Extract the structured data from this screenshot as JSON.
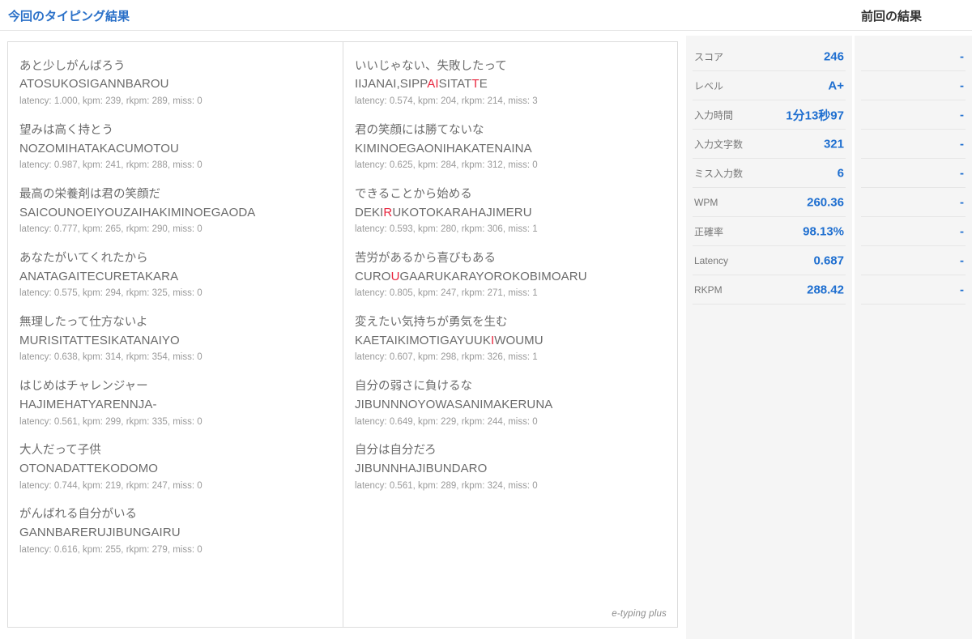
{
  "header": {
    "current_title": "今回のタイピング結果",
    "previous_title": "前回の結果"
  },
  "brand": "e-typing plus",
  "results": {
    "left_column": [
      {
        "kana": "あと少しがんばろう",
        "roman_segments": [
          {
            "text": "ATOSUKOSIGANNBAROU",
            "miss": false
          }
        ],
        "stats": "latency: 1.000, kpm: 239, rkpm: 289, miss: 0"
      },
      {
        "kana": "望みは高く持とう",
        "roman_segments": [
          {
            "text": "NOZOMIHATAKACUMOTOU",
            "miss": false
          }
        ],
        "stats": "latency: 0.987, kpm: 241, rkpm: 288, miss: 0"
      },
      {
        "kana": "最高の栄養剤は君の笑顔だ",
        "roman_segments": [
          {
            "text": "SAICOUNOEIYOUZAIHAKIMINOEGAODA",
            "miss": false
          }
        ],
        "stats": "latency: 0.777, kpm: 265, rkpm: 290, miss: 0"
      },
      {
        "kana": "あなたがいてくれたから",
        "roman_segments": [
          {
            "text": "ANATAGAITECURETAKARA",
            "miss": false
          }
        ],
        "stats": "latency: 0.575, kpm: 294, rkpm: 325, miss: 0"
      },
      {
        "kana": "無理したって仕方ないよ",
        "roman_segments": [
          {
            "text": "MURISITATTESIKATANAIYO",
            "miss": false
          }
        ],
        "stats": "latency: 0.638, kpm: 314, rkpm: 354, miss: 0"
      },
      {
        "kana": "はじめはチャレンジャー",
        "roman_segments": [
          {
            "text": "HAJIMEHATYARENNJA-",
            "miss": false
          }
        ],
        "stats": "latency: 0.561, kpm: 299, rkpm: 335, miss: 0"
      },
      {
        "kana": "大人だって子供",
        "roman_segments": [
          {
            "text": "OTONADATTEKODOMO",
            "miss": false
          }
        ],
        "stats": "latency: 0.744, kpm: 219, rkpm: 247, miss: 0"
      },
      {
        "kana": "がんばれる自分がいる",
        "roman_segments": [
          {
            "text": "GANNBARERUJIBUNGAIRU",
            "miss": false
          }
        ],
        "stats": "latency: 0.616, kpm: 255, rkpm: 279, miss: 0"
      }
    ],
    "right_column": [
      {
        "kana": "いいじゃない、失敗したって",
        "roman_segments": [
          {
            "text": "IIJANAI,SIPP",
            "miss": false
          },
          {
            "text": "AI",
            "miss": true
          },
          {
            "text": "SITAT",
            "miss": false
          },
          {
            "text": "T",
            "miss": true
          },
          {
            "text": "E",
            "miss": false
          }
        ],
        "stats": "latency: 0.574, kpm: 204, rkpm: 214, miss: 3"
      },
      {
        "kana": "君の笑顔には勝てないな",
        "roman_segments": [
          {
            "text": "KIMINOEGAONIHAKATENAINA",
            "miss": false
          }
        ],
        "stats": "latency: 0.625, kpm: 284, rkpm: 312, miss: 0"
      },
      {
        "kana": "できることから始める",
        "roman_segments": [
          {
            "text": "DEKI",
            "miss": false
          },
          {
            "text": "R",
            "miss": true
          },
          {
            "text": "UKOTOKARAHAJIMERU",
            "miss": false
          }
        ],
        "stats": "latency: 0.593, kpm: 280, rkpm: 306, miss: 1"
      },
      {
        "kana": "苦労があるから喜びもある",
        "roman_segments": [
          {
            "text": "CURO",
            "miss": false
          },
          {
            "text": "U",
            "miss": true
          },
          {
            "text": "GAARUKARAYOROKOBIMOARU",
            "miss": false
          }
        ],
        "stats": "latency: 0.805, kpm: 247, rkpm: 271, miss: 1"
      },
      {
        "kana": "変えたい気持ちが勇気を生む",
        "roman_segments": [
          {
            "text": "KAETAIKIMOTIGAYUUK",
            "miss": false
          },
          {
            "text": "I",
            "miss": true
          },
          {
            "text": "WOUMU",
            "miss": false
          }
        ],
        "stats": "latency: 0.607, kpm: 298, rkpm: 326, miss: 1"
      },
      {
        "kana": "自分の弱さに負けるな",
        "roman_segments": [
          {
            "text": "JIBUNNNOYOWASANIMAKERUNA",
            "miss": false
          }
        ],
        "stats": "latency: 0.649, kpm: 229, rkpm: 244, miss: 0"
      },
      {
        "kana": "自分は自分だろ",
        "roman_segments": [
          {
            "text": "JIBUNNHAJIBUNDARO",
            "miss": false
          }
        ],
        "stats": "latency: 0.561, kpm: 289, rkpm: 324, miss: 0"
      }
    ]
  },
  "stats": {
    "current": [
      {
        "label": "スコア",
        "value": "246"
      },
      {
        "label": "レベル",
        "value": "A+"
      },
      {
        "label": "入力時間",
        "value": "1分13秒97"
      },
      {
        "label": "入力文字数",
        "value": "321"
      },
      {
        "label": "ミス入力数",
        "value": "6"
      },
      {
        "label": "WPM",
        "value": "260.36"
      },
      {
        "label": "正確率",
        "value": "98.13%"
      },
      {
        "label": "Latency",
        "value": "0.687"
      },
      {
        "label": "RKPM",
        "value": "288.42"
      }
    ],
    "previous": [
      {
        "value": "-"
      },
      {
        "value": "-"
      },
      {
        "value": "-"
      },
      {
        "value": "-"
      },
      {
        "value": "-"
      },
      {
        "value": "-"
      },
      {
        "value": "-"
      },
      {
        "value": "-"
      },
      {
        "value": "-"
      }
    ]
  },
  "colors": {
    "accent_blue": "#1f6fd0",
    "header_blue": "#2a70c8",
    "miss_red": "#e8243c",
    "panel_gray": "#f5f5f5"
  }
}
